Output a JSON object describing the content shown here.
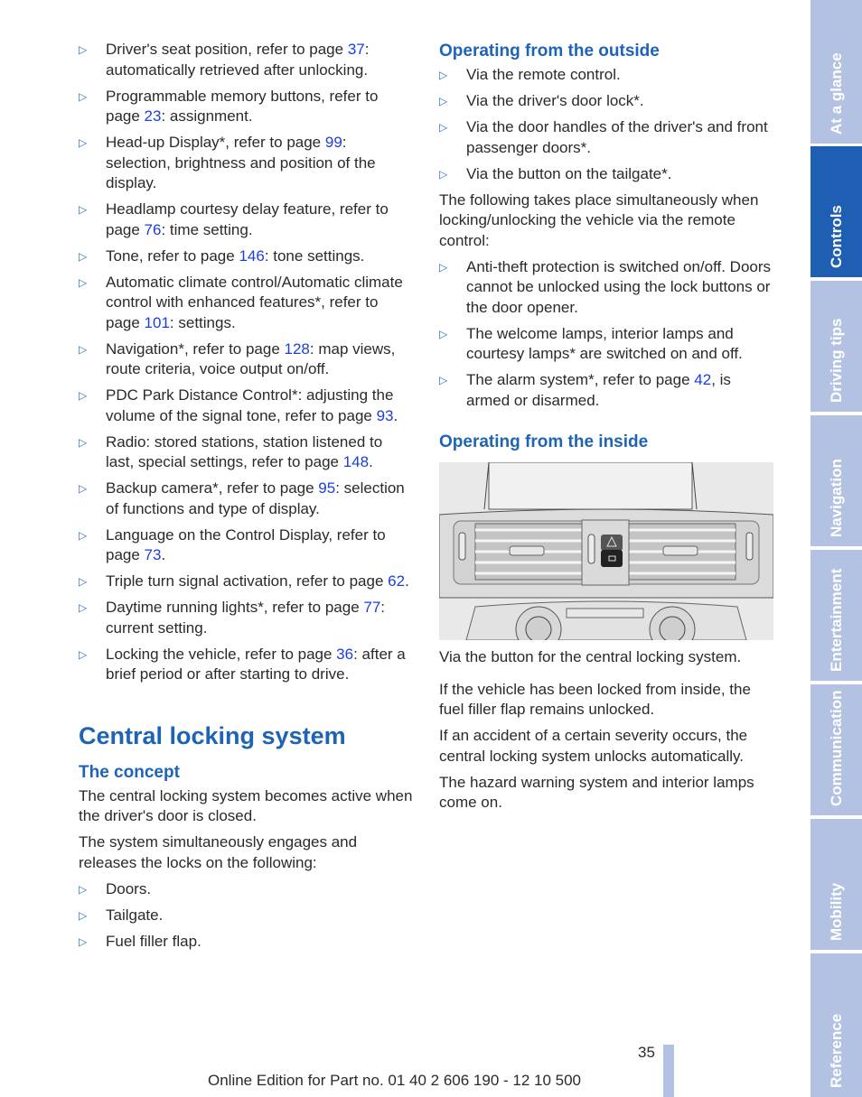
{
  "left_list": [
    {
      "pre": "Driver's seat position, refer to page ",
      "ref": "37",
      "post": ": automatically retrieved after unlocking."
    },
    {
      "pre": "Programmable memory buttons, refer to page ",
      "ref": "23",
      "post": ": assignment."
    },
    {
      "pre": "Head-up Display*, refer to page ",
      "ref": "99",
      "post": ": selection, brightness and position of the display."
    },
    {
      "pre": "Headlamp courtesy delay feature, refer to page ",
      "ref": "76",
      "post": ": time setting."
    },
    {
      "pre": "Tone, refer to page ",
      "ref": "146",
      "post": ": tone settings."
    },
    {
      "pre": "Automatic climate control/Automatic climate control with enhanced features*, refer to page ",
      "ref": "101",
      "post": ": settings."
    },
    {
      "pre": "Navigation*, refer to page ",
      "ref": "128",
      "post": ": map views, route criteria, voice output on/off."
    },
    {
      "pre": "PDC Park Distance Control*: adjusting the volume of the signal tone, refer to page ",
      "ref": "93",
      "post": "."
    },
    {
      "pre": "Radio: stored stations, station listened to last, special settings, refer to page ",
      "ref": "148",
      "post": "."
    },
    {
      "pre": "Backup camera*, refer to page ",
      "ref": "95",
      "post": ": selection of functions and type of display."
    },
    {
      "pre": "Language on the Control Display, refer to page ",
      "ref": "73",
      "post": "."
    },
    {
      "pre": "Triple turn signal activation, refer to page ",
      "ref": "62",
      "post": "."
    },
    {
      "pre": "Daytime running lights*, refer to page ",
      "ref": "77",
      "post": ": current setting."
    },
    {
      "pre": "Locking the vehicle, refer to page ",
      "ref": "36",
      "post": ": after a brief period or after starting to drive."
    }
  ],
  "section_title": "Central locking system",
  "concept": {
    "heading": "The concept",
    "para1": "The central locking system becomes active when the driver's door is closed.",
    "para2": "The system simultaneously engages and releases the locks on the following:",
    "items": [
      "Doors.",
      "Tailgate.",
      "Fuel filler flap."
    ]
  },
  "outside": {
    "heading": "Operating from the outside",
    "items": [
      "Via the remote control.",
      "Via the driver's door lock*.",
      "Via the door handles of the driver's and front passenger doors*.",
      "Via the button on the tailgate*."
    ],
    "para": "The following takes place simultaneously when locking/unlocking the vehicle via the remote control:",
    "effects": [
      {
        "pre": "Anti-theft protection is switched on/off. Doors cannot be unlocked using the lock buttons or the door opener.",
        "ref": "",
        "post": ""
      },
      {
        "pre": "The welcome lamps, interior lamps and courtesy lamps* are switched on and off.",
        "ref": "",
        "post": ""
      },
      {
        "pre": "The alarm system*, refer to page ",
        "ref": "42",
        "post": ", is armed or disarmed."
      }
    ]
  },
  "inside": {
    "heading": "Operating from the inside",
    "figure_alt": "Center console air vents with hazard warning button and central locking button",
    "caption": "Via the button for the central locking system.",
    "paras": [
      "If the vehicle has been locked from inside, the fuel filler flap remains unlocked.",
      "If an accident of a certain severity occurs, the central locking system unlocks automatically.",
      "The hazard warning system and interior lamps come on."
    ]
  },
  "sidebar": {
    "tabs": [
      {
        "label": "At a glance",
        "active": false
      },
      {
        "label": "Controls",
        "active": true
      },
      {
        "label": "Driving tips",
        "active": false
      },
      {
        "label": "Navigation",
        "active": false
      },
      {
        "label": "Entertainment",
        "active": false
      },
      {
        "label": "Communication",
        "active": false
      },
      {
        "label": "Mobility",
        "active": false
      },
      {
        "label": "Reference",
        "active": false
      }
    ]
  },
  "footer": {
    "page_number": "35",
    "edition": "Online Edition for Part no. 01 40 2 606 190 - 12 10 500"
  },
  "colors": {
    "accent": "#1e64b6",
    "link": "#1b3ee0",
    "tab": "#b3c1e3",
    "tab_active": "#1e5fb3"
  }
}
